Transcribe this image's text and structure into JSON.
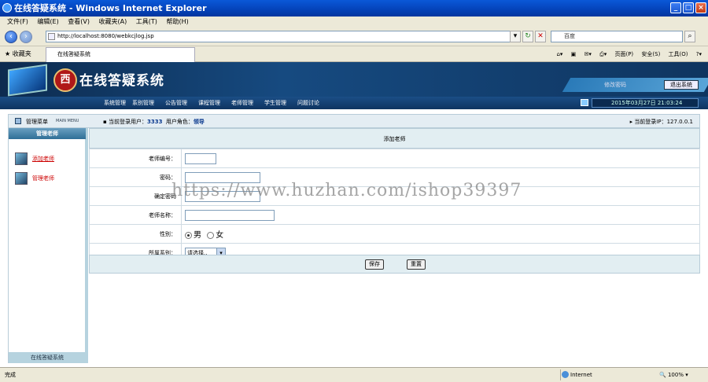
{
  "window": {
    "title": "在线答疑系统 - Windows Internet Explorer"
  },
  "menu": [
    "文件(F)",
    "编辑(E)",
    "查看(V)",
    "收藏夹(A)",
    "工具(T)",
    "帮助(H)"
  ],
  "address": {
    "url": "http://localhost:8080/webkcjlog.jsp"
  },
  "search": {
    "placeholder": "百度"
  },
  "favorites": {
    "label": "收藏夹",
    "tab_title": "在线答疑系统"
  },
  "ie_tools": [
    "页面(P)",
    "安全(S)",
    "工具(O)"
  ],
  "app": {
    "title": "在线答疑系统",
    "seal_char": "西",
    "change_password": "修改密码",
    "logout": "退出系统",
    "nav": [
      "系统管理",
      "系别管理",
      "公告管理",
      "课程管理",
      "老师管理",
      "学生管理",
      "问题讨论"
    ],
    "datetime": "2015年03月27日 21:03:24"
  },
  "status_strip": {
    "menu_label": "管理菜单",
    "menu_label_en": "MAIN MENU",
    "user_prefix": "当前登录用户：",
    "user": "3333",
    "role_prefix": "用户角色：",
    "role": "领导",
    "ip": "当前登录IP：127.0.0.1"
  },
  "sidebar": {
    "header": "管理老师",
    "items": [
      "添加老师",
      "管理老师"
    ],
    "footer": "在线答疑系统"
  },
  "form": {
    "title": "添加老师",
    "fields": {
      "teacher_no": "老师编号：",
      "password": "密码：",
      "confirm": "确定密码",
      "name": "老师名称：",
      "gender": "性别：",
      "department": "所属系别："
    },
    "gender_male": "男",
    "gender_female": "女",
    "dept_selected": "请选择..",
    "save": "保存",
    "reset": "重置"
  },
  "watermark": "https://www.huzhan.com/ishop39397",
  "statusbar": {
    "left": "完成",
    "zone": "Internet",
    "zoom": "100%"
  }
}
